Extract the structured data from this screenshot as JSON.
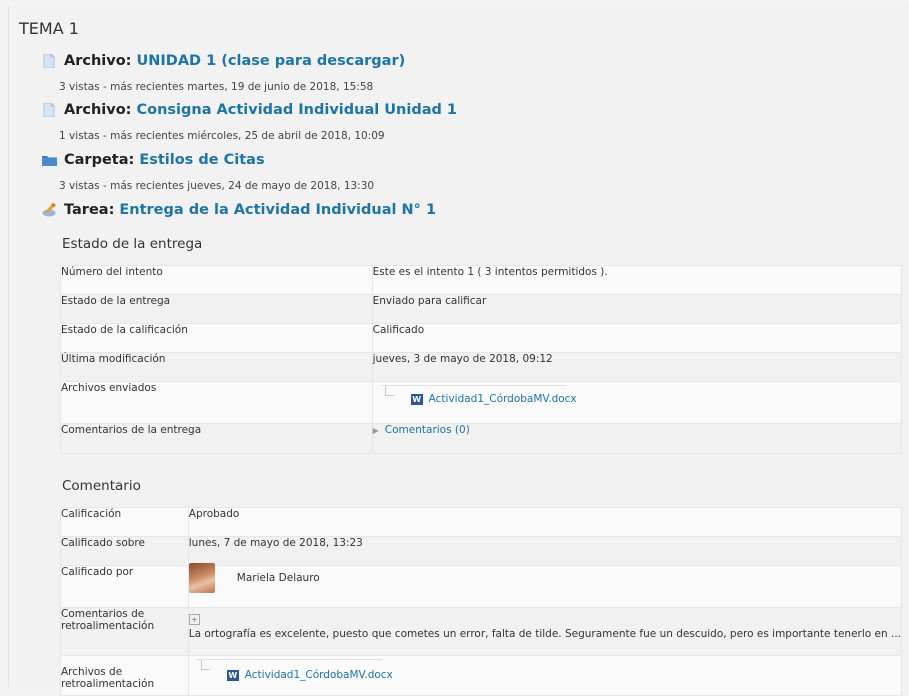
{
  "section": {
    "title": "TEMA 1"
  },
  "activities": [
    {
      "kind": "Archivo:",
      "title": "UNIDAD 1 (clase para descargar)",
      "meta": "3 vistas - más recientes martes, 19 de junio de 2018, 15:58",
      "icon": "file-icon"
    },
    {
      "kind": "Archivo:",
      "title": "Consigna Actividad Individual Unidad 1",
      "meta": "1 vistas - más recientes miércoles, 25 de abril de 2018, 10:09",
      "icon": "file-icon"
    },
    {
      "kind": "Carpeta:",
      "title": "Estilos de Citas",
      "meta": "3 vistas - más recientes jueves, 24 de mayo de 2018, 13:30",
      "icon": "folder-icon"
    },
    {
      "kind": "Tarea:",
      "title": "Entrega de la Actividad Individual N° 1",
      "icon": "assignment-icon"
    }
  ],
  "submission": {
    "heading": "Estado de la entrega",
    "rows": [
      {
        "label": "Número del intento",
        "value": "Este es el intento 1 ( 3 intentos permitidos )."
      },
      {
        "label": "Estado de la entrega",
        "value": "Enviado para calificar"
      },
      {
        "label": "Estado de la calificación",
        "value": "Calificado"
      },
      {
        "label": "Última modificación",
        "value": "jueves, 3 de mayo de 2018, 09:12"
      },
      {
        "label": "Archivos enviados",
        "value": "Actividad1_CórdobaMV.docx"
      },
      {
        "label": "Comentarios de la entrega",
        "value": "Comentarios (0)"
      }
    ]
  },
  "feedback": {
    "heading": "Comentario",
    "rows": [
      {
        "label": "Calificación",
        "value": "Aprobado"
      },
      {
        "label": "Calificado sobre",
        "value": "lunes, 7 de mayo de 2018, 13:23"
      },
      {
        "label": "Calificado por",
        "value": "Mariela Delauro"
      },
      {
        "label": "Comentarios de retroalimentación",
        "value": "La ortografía es excelente, puesto que cometes un error, falta de tilde. Seguramente fue un descuido, pero es importante tenerlo en ..."
      },
      {
        "label": "Archivos de retroalimentación",
        "value": "Actividad1_CórdobaMV.docx"
      }
    ]
  },
  "colors": {
    "link": "#1e73a8",
    "background": "#f2f2f2",
    "word": "#2b5797"
  }
}
